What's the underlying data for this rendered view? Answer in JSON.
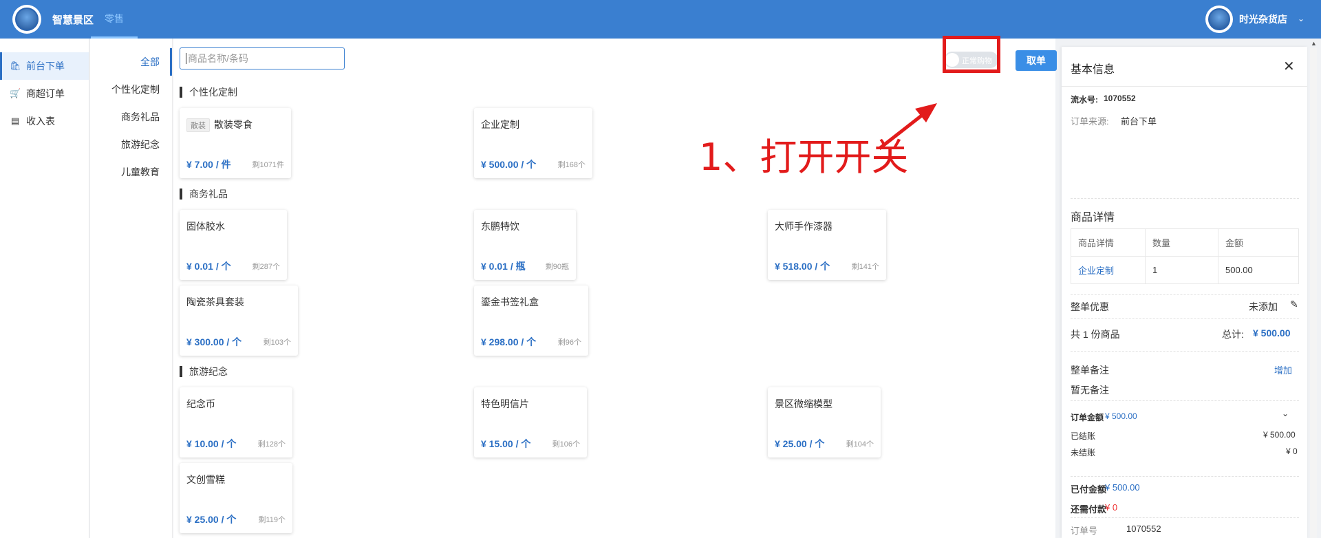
{
  "header": {
    "brand": "智慧景区",
    "menu_retail": "零售",
    "user_name": "时光杂货店"
  },
  "nav": {
    "items": [
      {
        "label": "前台下单",
        "icon": "shopping-bag-icon"
      },
      {
        "label": "商超订单",
        "icon": "cart-icon"
      },
      {
        "label": "收入表",
        "icon": "document-icon"
      }
    ]
  },
  "categories": [
    "全部",
    "个性化定制",
    "商务礼品",
    "旅游纪念",
    "儿童教育"
  ],
  "search": {
    "placeholder": "商品名称/条码"
  },
  "toggle": {
    "label": "正常购物"
  },
  "take_order": "取单",
  "annotation": "1、打开开关",
  "sections": [
    {
      "title": "个性化定制",
      "products": [
        {
          "tag": "散装",
          "name": "散装零食",
          "price": "¥ 7.00 / 件",
          "stock": "剩1071件"
        },
        {
          "tag": "",
          "name": "企业定制",
          "price": "¥ 500.00 / 个",
          "stock": "剩168个"
        }
      ]
    },
    {
      "title": "商务礼品",
      "products": [
        {
          "tag": "",
          "name": "固体胶水",
          "price": "¥ 0.01 / 个",
          "stock": "剩287个"
        },
        {
          "tag": "",
          "name": "东鹏特饮",
          "price": "¥ 0.01 / 瓶",
          "stock": "剩90瓶"
        },
        {
          "tag": "",
          "name": "大师手作漆器",
          "price": "¥ 518.00 / 个",
          "stock": "剩141个"
        },
        {
          "tag": "",
          "name": "陶瓷茶具套装",
          "price": "¥ 300.00 / 个",
          "stock": "剩103个"
        },
        {
          "tag": "",
          "name": "鎏金书签礼盒",
          "price": "¥ 298.00 / 个",
          "stock": "剩96个"
        }
      ]
    },
    {
      "title": "旅游纪念",
      "products": [
        {
          "tag": "",
          "name": "纪念币",
          "price": "¥ 10.00 / 个",
          "stock": "剩128个"
        },
        {
          "tag": "",
          "name": "特色明信片",
          "price": "¥ 15.00 / 个",
          "stock": "剩106个"
        },
        {
          "tag": "",
          "name": "景区微缩模型",
          "price": "¥ 25.00 / 个",
          "stock": "剩104个"
        },
        {
          "tag": "",
          "name": "文创雪糕",
          "price": "¥ 25.00 / 个",
          "stock": "剩119个"
        }
      ]
    }
  ],
  "panel": {
    "title": "基本信息",
    "serial_label": "流水号:",
    "serial_value": "1070552",
    "source_label": "订单来源:",
    "source_value": "前台下单",
    "detail_title": "商品详情",
    "table_headers": [
      "商品详情",
      "数量",
      "金额"
    ],
    "table_rows": [
      [
        "企业定制",
        "1",
        "500.00"
      ]
    ],
    "discount_label": "整单优惠",
    "discount_value": "未添加",
    "count_text": "共 1 份商品",
    "total_label": "总计:",
    "total_value": "¥ 500.00",
    "remark_label": "整单备注",
    "remark_add": "增加",
    "remark_value": "暂无备注",
    "order_amount_label": "订单金额",
    "order_amount_value": "¥ 500.00",
    "settled_label": "已结账",
    "settled_value": "¥ 500.00",
    "unsettled_label": "未结账",
    "unsettled_value": "¥ 0",
    "paid_label": "已付金额",
    "paid_value": "¥ 500.00",
    "due_label": "还需付款",
    "due_value": "¥ 0",
    "order_no_label": "订单号",
    "order_no_value": "1070552"
  },
  "colors": {
    "primary": "#3a7fd0",
    "accent": "#2b6fc4",
    "annotation": "#e21b1b",
    "danger": "#e33333"
  }
}
